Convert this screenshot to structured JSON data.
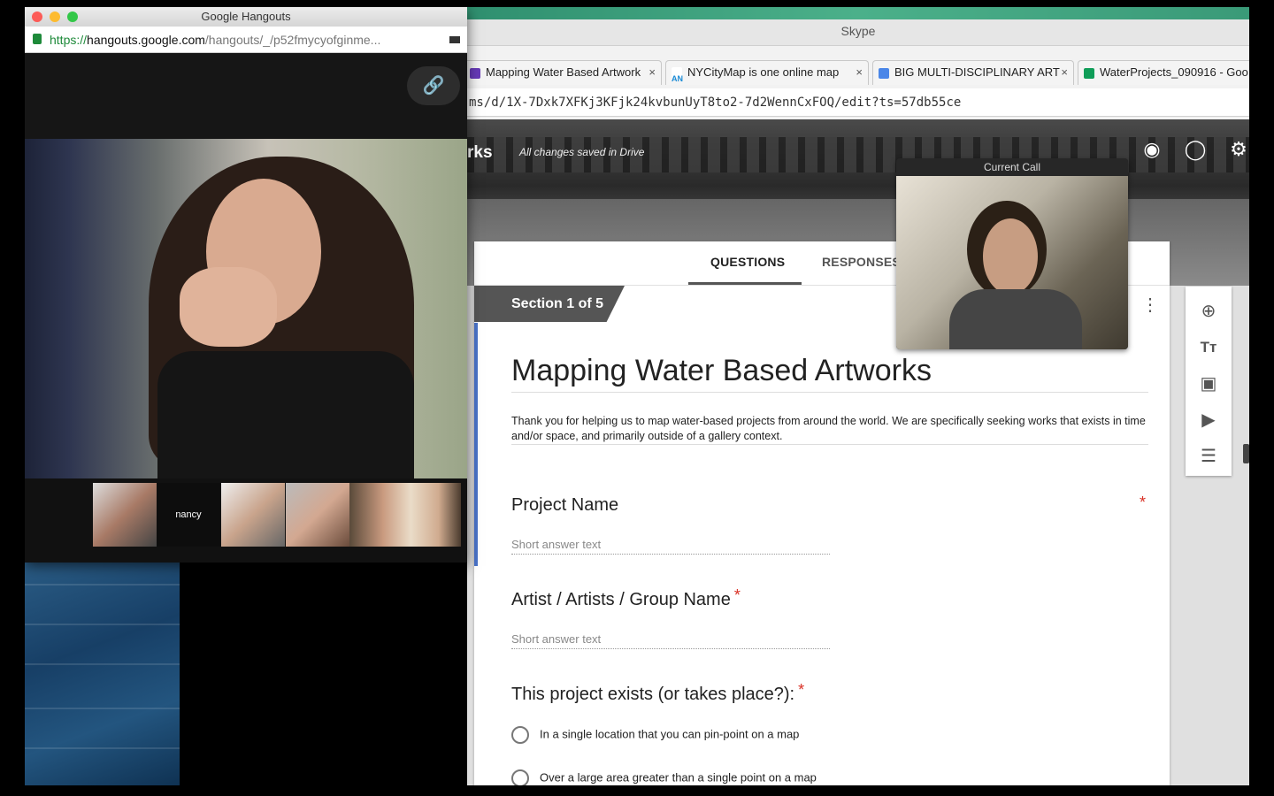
{
  "hangouts": {
    "window_title": "Google Hangouts",
    "url_scheme": "https://",
    "url_domain": "hangouts.google.com",
    "url_path": "/hangouts/_/p52fmycyofginme...",
    "participants": [
      {
        "name": ""
      },
      {
        "name": "nancy"
      },
      {
        "name": ""
      },
      {
        "name": ""
      },
      {
        "name": ""
      },
      {
        "name": ""
      }
    ]
  },
  "skype": {
    "window_title": "Skype",
    "current_call_label": "Current Call"
  },
  "browser": {
    "tabs": [
      {
        "label": "Mapping Water Based Artwork",
        "close": "×"
      },
      {
        "label": "NYCityMap is one online map",
        "close": "×"
      },
      {
        "label": "BIG MULTI-DISCIPLINARY ART",
        "close": "×"
      },
      {
        "label": "WaterProjects_090916 - Goo",
        "close": ""
      }
    ],
    "url": "ms/d/1X-7Dxk7XFKj3KFjk24kvbunUyT8to2-7d2WennCxFOQ/edit?ts=57db55ce"
  },
  "forms_header": {
    "doc_title_fragment": "rks",
    "saved_status": "All changes saved in Drive"
  },
  "form": {
    "tabs": [
      "QUESTIONS",
      "RESPONSES"
    ],
    "section_label": "Section 1 of 5",
    "title": "Mapping Water Based Artworks",
    "description": "Thank you for helping us to map water-based projects from around the world. We are specifically seeking works that exists in time and/or space, and primarily outside of a gallery context.",
    "questions": [
      {
        "label": "Project Name",
        "placeholder": "Short answer text",
        "required_marker": "*"
      },
      {
        "label": "Artist / Artists / Group Name",
        "placeholder": "Short answer text",
        "required_marker": "*"
      },
      {
        "label": "This project exists (or takes place?):",
        "required_marker": "*",
        "options": [
          "In a single location that you can pin-point on a map",
          "Over a large area greater than a single point on a map"
        ]
      }
    ]
  },
  "colors": {
    "accent": "#4a73c9",
    "required": "#d93025",
    "section": "#555555"
  }
}
